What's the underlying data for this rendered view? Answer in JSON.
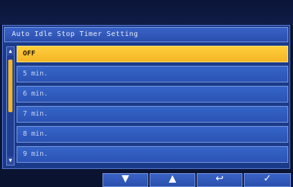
{
  "screen": {
    "title": "Auto Idle Stop Timer Setting"
  },
  "options": [
    {
      "label": "OFF",
      "selected": true
    },
    {
      "label": "5 min.",
      "selected": false
    },
    {
      "label": "6 min.",
      "selected": false
    },
    {
      "label": "7 min.",
      "selected": false
    },
    {
      "label": "8 min.",
      "selected": false
    },
    {
      "label": "9 min.",
      "selected": false
    }
  ],
  "scrollbar": {
    "up_arrow": "▲",
    "down_arrow": "▼"
  },
  "footer": {
    "down_icon": "▼",
    "up_icon": "▲",
    "back_icon": "↩",
    "ok_icon": "✓"
  },
  "colors": {
    "panel": "#1a3a8a",
    "selected": "#f4b526",
    "item": "#2a53b4"
  }
}
